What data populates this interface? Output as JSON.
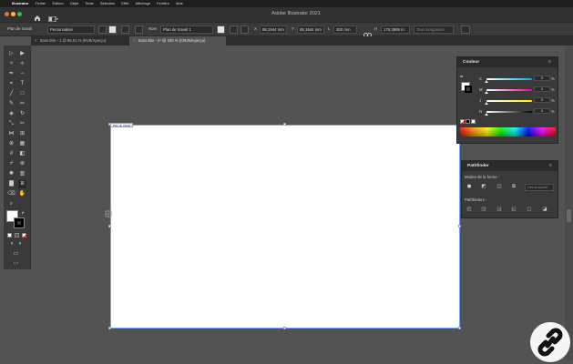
{
  "menubar": {
    "apple_glyph": "",
    "items": [
      "Illustrator",
      "Fichier",
      "Edition",
      "Objet",
      "Texte",
      "Sélection",
      "Effet",
      "Affichage",
      "Fenêtre",
      "Aide"
    ]
  },
  "window": {
    "title": "Adobe Illustrator 2021",
    "traffic_colors": [
      "#ff5f57",
      "#febc2e",
      "#28c840"
    ]
  },
  "control_bar": {
    "context_label": "Plan de travail",
    "preset_value": "Personnalisé",
    "name_label": "Nom",
    "name_value": "Plan de travail 1",
    "x_label": "X",
    "x_value": "88,1944 mm",
    "y_label": "Y",
    "y_value": "88,1944 mm",
    "l_label": "L",
    "l_value": "300 mm",
    "h_label": "H",
    "h_value": "176,3889 m",
    "all_button": "Tout réorganiser"
  },
  "tabs": [
    {
      "label": "Sans titre - 1 @ 66,51 % (RVB/Aperçu)",
      "active": false
    },
    {
      "label": "Sans titre - 2* @ 100 % (CMJN/Aperçu)",
      "active": true
    }
  ],
  "artboard": {
    "label": "Plan de travail"
  },
  "color_panel": {
    "title": "Couleur",
    "channels": [
      {
        "label": "C",
        "value": "0",
        "unit": "%",
        "level": 0,
        "gradient": "linear-gradient(90deg,#ffffff,#00aeef)"
      },
      {
        "label": "M",
        "value": "0",
        "unit": "%",
        "level": 0,
        "gradient": "linear-gradient(90deg,#ffffff,#ec008c)"
      },
      {
        "label": "J",
        "value": "0",
        "unit": "%",
        "level": 0,
        "gradient": "linear-gradient(90deg,#ffffff,#fff200)"
      },
      {
        "label": "N",
        "value": "0",
        "unit": "%",
        "level": 0,
        "gradient": "linear-gradient(90deg,#ffffff,#000000)"
      }
    ]
  },
  "pathfinder_panel": {
    "title": "Pathfinder",
    "shape_modes_label": "Modes de la forme :",
    "expand_button": "Décomposer",
    "pathfinders_label": "Pathfinders :"
  },
  "colors": {
    "accent_selection": "#7aa2ff",
    "panel_bg": "#3a3a3a",
    "workspace_bg": "#535353"
  }
}
